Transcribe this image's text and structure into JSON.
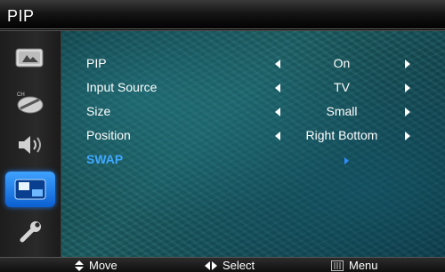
{
  "window": {
    "title": "PIP"
  },
  "sidebar": {
    "items": [
      {
        "icon": "picture-icon",
        "active": false
      },
      {
        "icon": "channel-satellite-icon",
        "active": false
      },
      {
        "icon": "speaker-icon",
        "active": false
      },
      {
        "icon": "pip-setup-icon",
        "active": true
      },
      {
        "icon": "wrench-icon",
        "active": false
      }
    ]
  },
  "menu": {
    "rows": [
      {
        "label": "PIP",
        "value": "On"
      },
      {
        "label": "Input Source",
        "value": "TV"
      },
      {
        "label": "Size",
        "value": "Small"
      },
      {
        "label": "Position",
        "value": "Right Bottom"
      },
      {
        "label": "SWAP",
        "value": ""
      }
    ],
    "selected_index": 4
  },
  "footer": {
    "move_label": "Move",
    "select_label": "Select",
    "menu_label": "Menu"
  },
  "colors": {
    "accent": "#3ea8ff",
    "active_icon_bg": "#1a74e8",
    "content_bg": "#1b5d62"
  }
}
